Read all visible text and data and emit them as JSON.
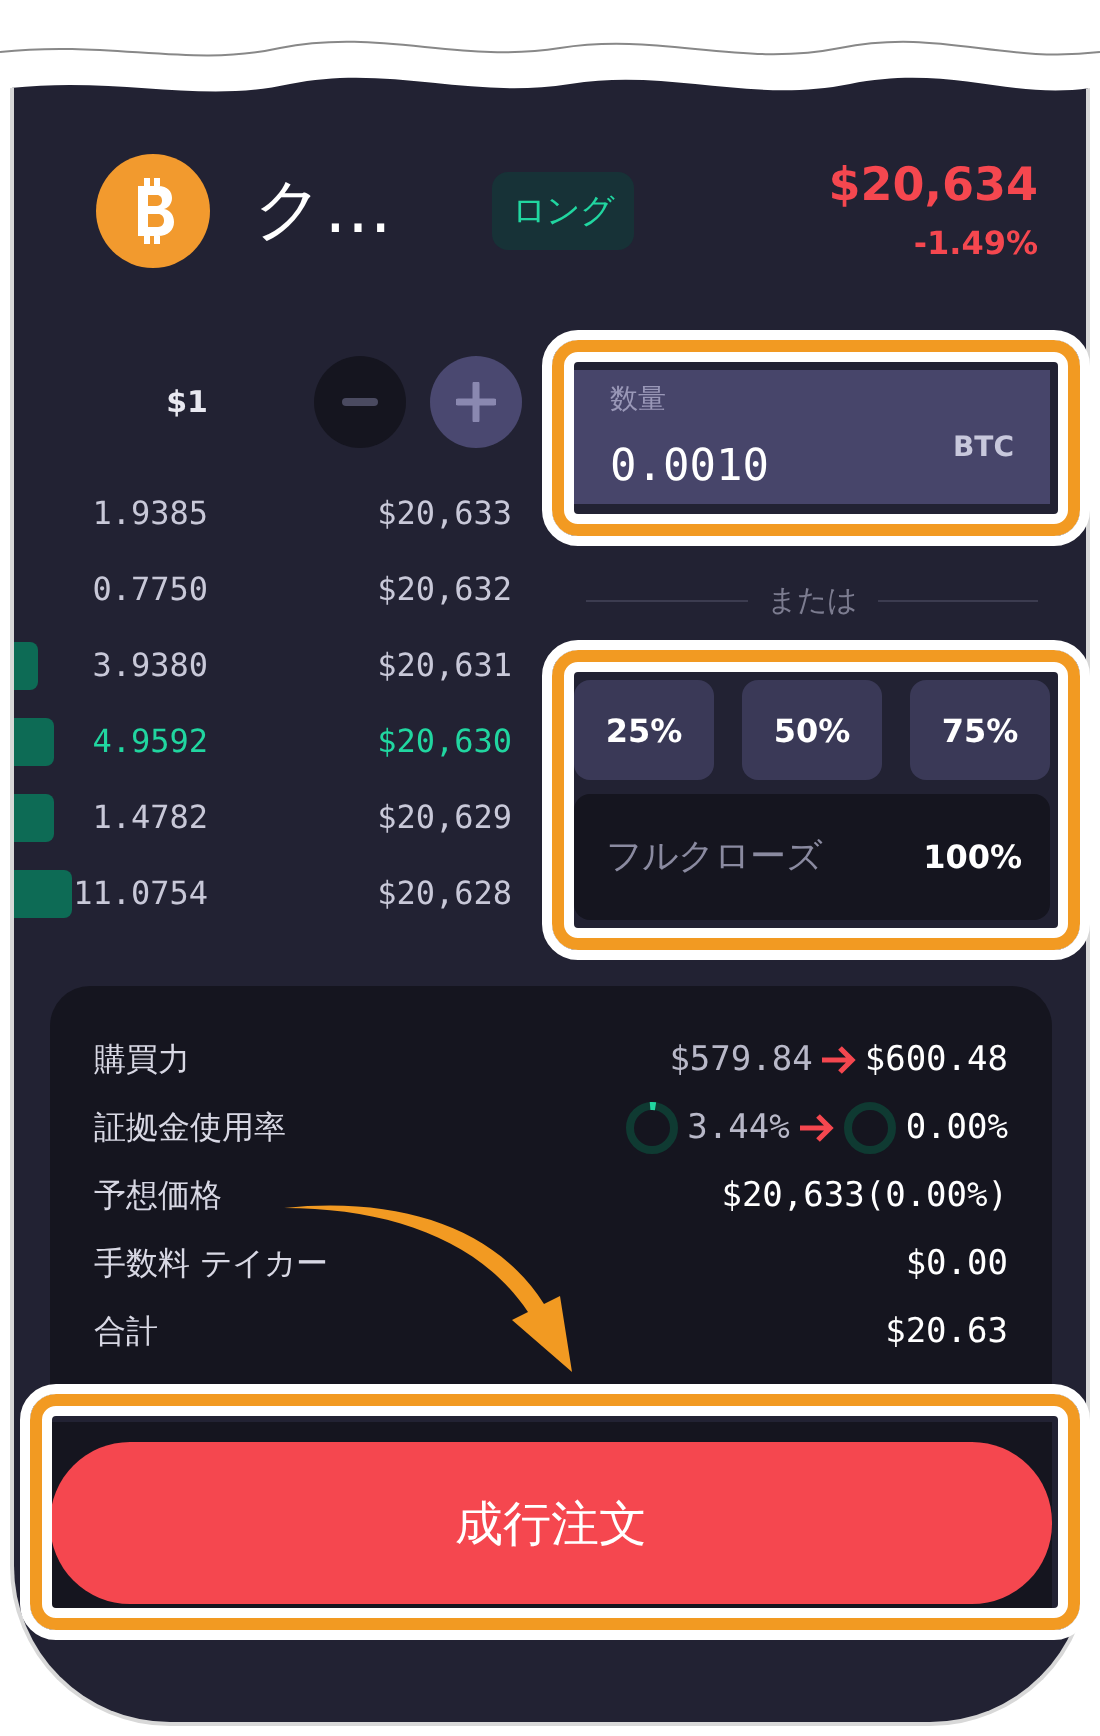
{
  "asset": {
    "name": "ク…",
    "position_badge": "ロング",
    "price": "$20,634",
    "change": "-1.49%"
  },
  "order_book": {
    "tick_size": "$1",
    "rows": [
      {
        "quantity": "1.9385",
        "price": "$20,633",
        "highlighted": false
      },
      {
        "quantity": "0.7750",
        "price": "$20,632",
        "highlighted": false
      },
      {
        "quantity": "3.9380",
        "price": "$20,631",
        "highlighted": false
      },
      {
        "quantity": "4.9592",
        "price": "$20,630",
        "highlighted": true
      },
      {
        "quantity": "1.4782",
        "price": "$20,629",
        "highlighted": false
      },
      {
        "quantity": "11.0754",
        "price": "$20,628",
        "highlighted": false
      }
    ]
  },
  "quantity_field": {
    "label": "数量",
    "value": "0.0010",
    "unit": "BTC"
  },
  "divider_text": "または",
  "percent_buttons": [
    "25%",
    "50%",
    "75%"
  ],
  "full_close": {
    "label": "フルクローズ",
    "value": "100%"
  },
  "summary": [
    {
      "kind": "change",
      "label": "購買力",
      "from": {
        "text": "$579.84"
      },
      "to": {
        "text": "$600.48"
      }
    },
    {
      "kind": "gauge_change",
      "label": "証拠金使用率",
      "from": {
        "text": "3.44%"
      },
      "to": {
        "text": "0.00%"
      }
    },
    {
      "kind": "value",
      "label": "予想価格",
      "value": "$20,633(0.00%)"
    },
    {
      "kind": "value",
      "label": "手数料 テイカー",
      "value": "$0.00"
    },
    {
      "kind": "value",
      "label": "合計",
      "value": "$20.63"
    }
  ],
  "order_button": "成行注文"
}
